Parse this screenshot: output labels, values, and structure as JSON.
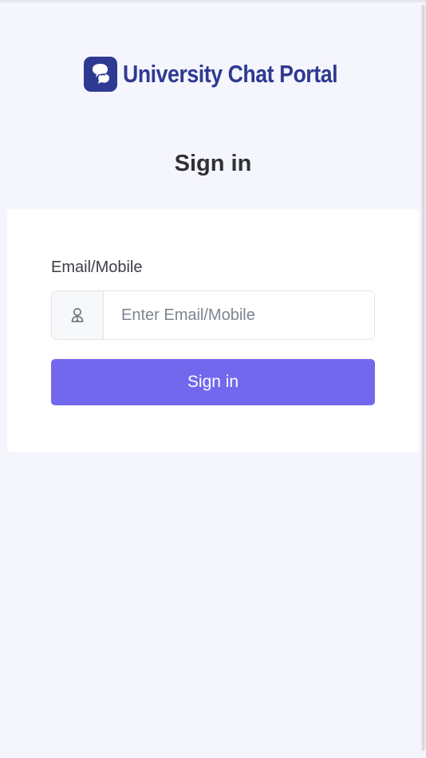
{
  "brand": {
    "name": "University Chat Portal",
    "logo_icon": "chat-bubbles-icon",
    "color": "#2e3a92"
  },
  "page": {
    "title": "Sign in"
  },
  "form": {
    "email_label": "Email/Mobile",
    "email_placeholder": "Enter Email/Mobile",
    "email_value": "",
    "user_icon": "user-icon",
    "submit_label": "Sign in",
    "submit_color": "#7168ee"
  }
}
